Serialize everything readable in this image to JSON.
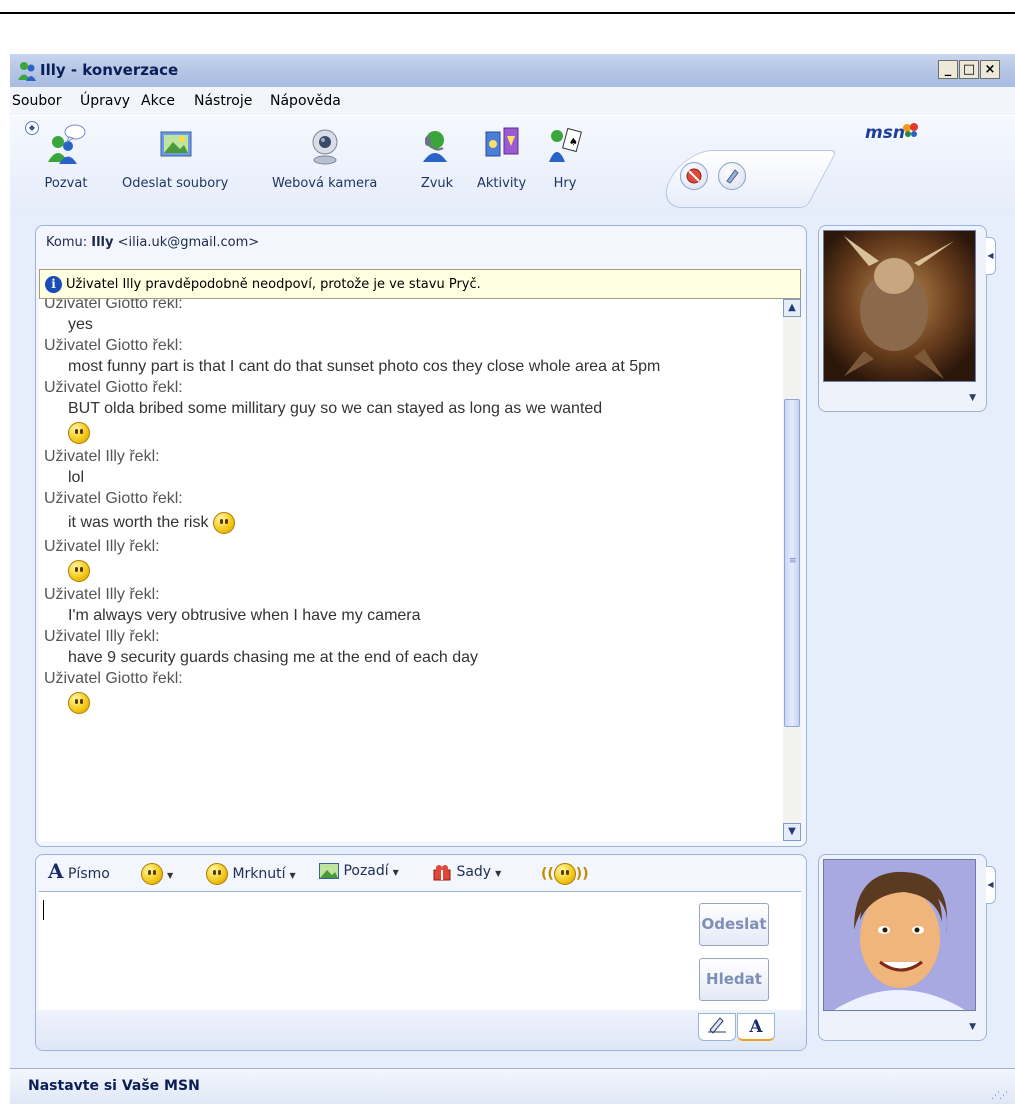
{
  "window": {
    "title": "Illy - konverzace",
    "controls": {
      "minimize": "_",
      "maximize": "□",
      "close": "×"
    }
  },
  "menu": [
    "Soubor",
    "Úpravy",
    "Akce",
    "Nástroje",
    "Nápověda"
  ],
  "toolbar": {
    "items": [
      {
        "label": "Pozvat",
        "icon": "invite-contact-icon"
      },
      {
        "label": "Odeslat soubory",
        "icon": "send-files-icon"
      },
      {
        "label": "Webová kamera",
        "icon": "webcam-icon"
      },
      {
        "label": "Zvuk",
        "icon": "audio-icon"
      },
      {
        "label": "Aktivity",
        "icon": "activities-icon"
      },
      {
        "label": "Hry",
        "icon": "games-icon"
      }
    ],
    "brand": "msn"
  },
  "conversation": {
    "to_prefix": "Komu:",
    "to_name": "Illy",
    "to_email": "<ilia.uk@gmail.com>",
    "warning": "Uživatel Illy pravděpodobně neodpoví, protože je ve stavu Pryč.",
    "messages": [
      {
        "speaker": "Uživatel Giotto řekl:"
      },
      {
        "text": "yes"
      },
      {
        "speaker": "Uživatel Giotto řekl:"
      },
      {
        "text": "most funny part is that I cant do that sunset photo cos they close whole area at 5pm"
      },
      {
        "speaker": "Uživatel Giotto řekl:"
      },
      {
        "text": "BUT olda bribed some millitary guy so we can stayed as long as we wanted"
      },
      {
        "speaker": "Uživatel Illy řekl:"
      },
      {
        "text": "lol"
      },
      {
        "speaker": "Uživatel Giotto řekl:"
      },
      {
        "text": "it was worth the risk"
      },
      {
        "speaker": "Uživatel Illy řekl:"
      },
      {
        "speaker": "Uživatel Illy řekl:"
      },
      {
        "text": "I'm always very obtrusive when I have my camera"
      },
      {
        "speaker": "Uživatel Illy řekl:"
      },
      {
        "text": "have 9 security guards chasing me at the end of each day"
      },
      {
        "speaker": "Uživatel Giotto řekl:"
      }
    ]
  },
  "format_bar": {
    "font_glyph": "A",
    "font_label": "Písmo",
    "wink_label": "Mrknutí",
    "background_label": "Pozadí",
    "sets_label": "Sady"
  },
  "compose": {
    "send_label": "Odeslat",
    "search_label": "Hledat",
    "text_tab_glyph": "A"
  },
  "statusbar": {
    "text": "Nastavte si Vaše MSN"
  }
}
